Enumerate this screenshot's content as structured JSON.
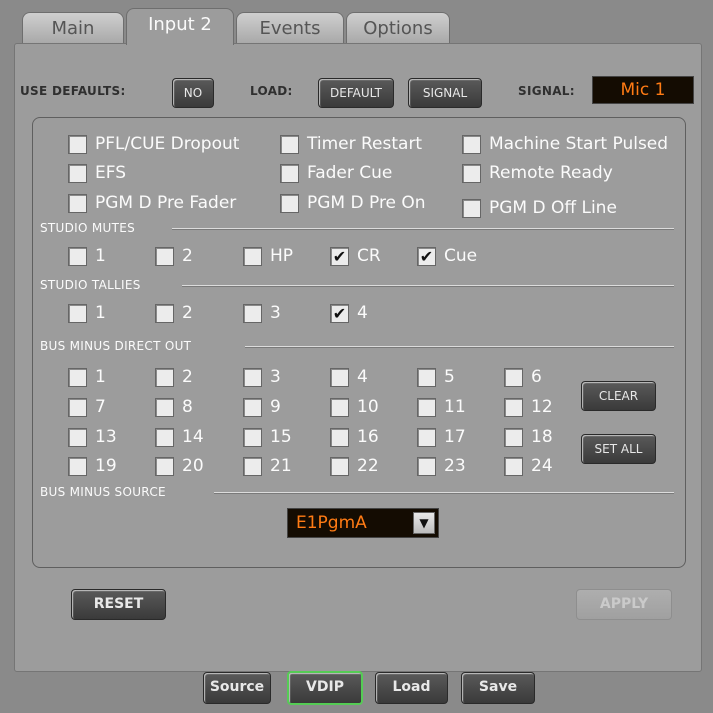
{
  "tabs": [
    {
      "label": "Main",
      "active": false
    },
    {
      "label": "Input 2",
      "active": true
    },
    {
      "label": "Events",
      "active": false
    },
    {
      "label": "Options",
      "active": false
    }
  ],
  "top_bar": {
    "use_defaults_label": "USE DEFAULTS:",
    "use_defaults_value": "NO",
    "load_label": "LOAD:",
    "default_button": "DEFAULT",
    "signal_button": "SIGNAL",
    "signal_label": "SIGNAL:",
    "signal_value": "Mic 1"
  },
  "options": [
    {
      "label": "PFL/CUE Dropout",
      "checked": false
    },
    {
      "label": "Timer Restart",
      "checked": false
    },
    {
      "label": "Machine Start Pulsed",
      "checked": false
    },
    {
      "label": "EFS",
      "checked": false
    },
    {
      "label": "Fader Cue",
      "checked": false
    },
    {
      "label": "Remote Ready",
      "checked": false
    },
    {
      "label": "PGM D Pre Fader",
      "checked": false
    },
    {
      "label": "PGM D Pre On",
      "checked": false
    },
    {
      "label": "PGM D Off Line",
      "checked": false
    }
  ],
  "studio_mutes": {
    "title": "STUDIO MUTES",
    "items": [
      {
        "label": "1",
        "checked": false
      },
      {
        "label": "2",
        "checked": false
      },
      {
        "label": "HP",
        "checked": false
      },
      {
        "label": "CR",
        "checked": true
      },
      {
        "label": "Cue",
        "checked": true
      }
    ]
  },
  "studio_tallies": {
    "title": "STUDIO TALLIES",
    "items": [
      {
        "label": "1",
        "checked": false
      },
      {
        "label": "2",
        "checked": false
      },
      {
        "label": "3",
        "checked": false
      },
      {
        "label": "4",
        "checked": true
      }
    ]
  },
  "bus_minus_direct_out": {
    "title": "BUS MINUS DIRECT OUT",
    "items": [
      {
        "label": "1",
        "checked": false
      },
      {
        "label": "2",
        "checked": false
      },
      {
        "label": "3",
        "checked": false
      },
      {
        "label": "4",
        "checked": false
      },
      {
        "label": "5",
        "checked": false
      },
      {
        "label": "6",
        "checked": false
      },
      {
        "label": "7",
        "checked": false
      },
      {
        "label": "8",
        "checked": false
      },
      {
        "label": "9",
        "checked": false
      },
      {
        "label": "10",
        "checked": false
      },
      {
        "label": "11",
        "checked": false
      },
      {
        "label": "12",
        "checked": false
      },
      {
        "label": "13",
        "checked": false
      },
      {
        "label": "14",
        "checked": false
      },
      {
        "label": "15",
        "checked": false
      },
      {
        "label": "16",
        "checked": false
      },
      {
        "label": "17",
        "checked": false
      },
      {
        "label": "18",
        "checked": false
      },
      {
        "label": "19",
        "checked": false
      },
      {
        "label": "20",
        "checked": false
      },
      {
        "label": "21",
        "checked": false
      },
      {
        "label": "22",
        "checked": false
      },
      {
        "label": "23",
        "checked": false
      },
      {
        "label": "24",
        "checked": false
      }
    ],
    "clear_button": "CLEAR",
    "set_all_button": "SET ALL"
  },
  "bus_minus_source": {
    "title": "BUS MINUS SOURCE",
    "value": "E1PgmA"
  },
  "reset_button": "RESET",
  "apply_button": "APPLY",
  "bottom_buttons": [
    "Source",
    "VDIP",
    "Load",
    "Save"
  ],
  "check_mark": "✔",
  "dropdown_arrow": "▼",
  "colors": {
    "background": "#9c9c9c",
    "display_bg": "#140c02",
    "display_text": "#ff7b14",
    "vdip_border": "#55cc55"
  }
}
